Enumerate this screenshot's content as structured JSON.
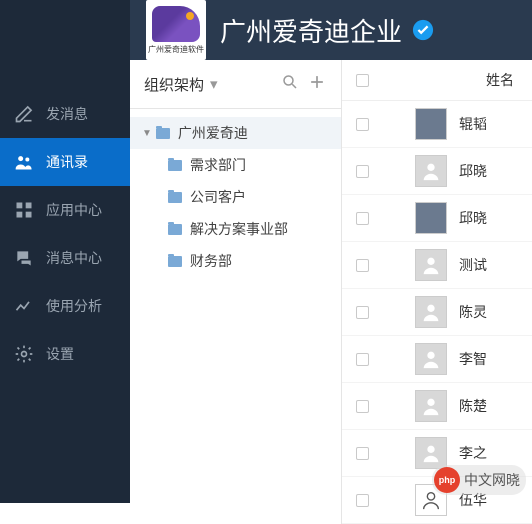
{
  "header": {
    "logo_text": "广州爱奇迪软件",
    "title": "广州爱奇迪企业"
  },
  "sidebar": {
    "items": [
      {
        "label": "发消息"
      },
      {
        "label": "通讯录"
      },
      {
        "label": "应用中心"
      },
      {
        "label": "消息中心"
      },
      {
        "label": "使用分析"
      },
      {
        "label": "设置"
      }
    ]
  },
  "tree": {
    "header": "组织架构",
    "root": "广州爱奇迪",
    "children": [
      {
        "label": "需求部门"
      },
      {
        "label": "公司客户"
      },
      {
        "label": "解决方案事业部"
      },
      {
        "label": "财务部"
      }
    ]
  },
  "contacts": {
    "columns": {
      "name": "姓名"
    },
    "rows": [
      {
        "name": "辊韬"
      },
      {
        "name": "邱晓"
      },
      {
        "name": "邱晓"
      },
      {
        "name": "测试"
      },
      {
        "name": "陈灵"
      },
      {
        "name": "李智"
      },
      {
        "name": "陈楚"
      },
      {
        "name": "李之"
      },
      {
        "name": "伍华"
      }
    ]
  },
  "watermark": {
    "text": "中文网晓"
  }
}
